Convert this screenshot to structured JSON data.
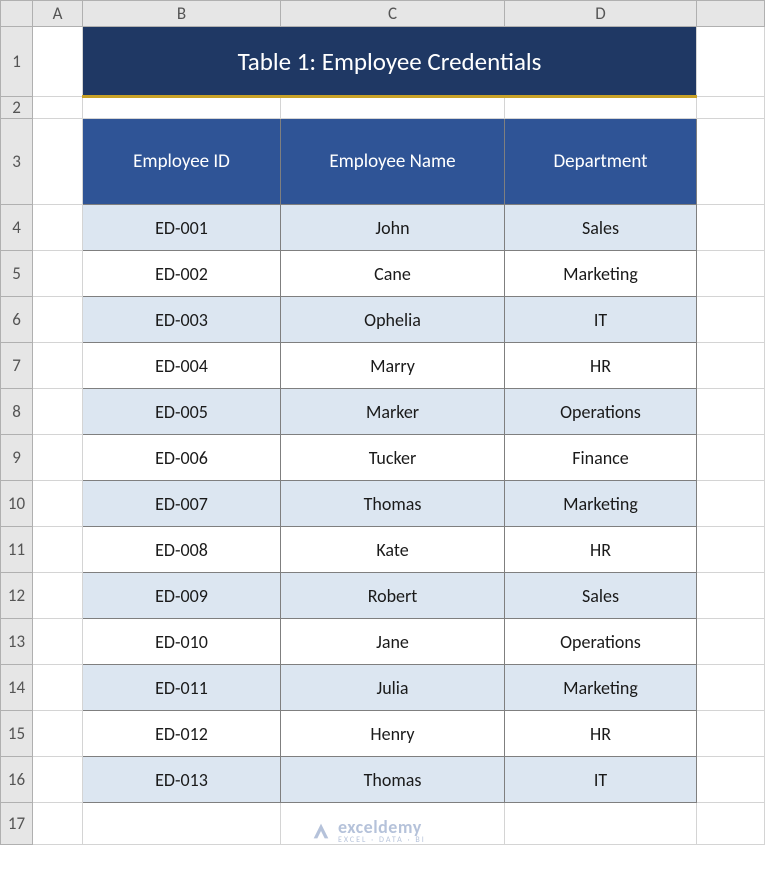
{
  "columns": [
    "",
    "A",
    "B",
    "C",
    "D",
    ""
  ],
  "row_numbers": [
    "1",
    "2",
    "3",
    "4",
    "5",
    "6",
    "7",
    "8",
    "9",
    "10",
    "11",
    "12",
    "13",
    "14",
    "15",
    "16",
    "17"
  ],
  "title": "Table 1: Employee Credentials",
  "headers": {
    "B": "Employee ID",
    "C": "Employee Name",
    "D": "Department"
  },
  "chart_data": {
    "type": "table",
    "title": "Table 1: Employee Credentials",
    "columns": [
      "Employee ID",
      "Employee Name",
      "Department"
    ],
    "rows": [
      [
        "ED-001",
        "John",
        "Sales"
      ],
      [
        "ED-002",
        "Cane",
        "Marketing"
      ],
      [
        "ED-003",
        "Ophelia",
        "IT"
      ],
      [
        "ED-004",
        "Marry",
        "HR"
      ],
      [
        "ED-005",
        "Marker",
        "Operations"
      ],
      [
        "ED-006",
        "Tucker",
        "Finance"
      ],
      [
        "ED-007",
        "Thomas",
        "Marketing"
      ],
      [
        "ED-008",
        "Kate",
        "HR"
      ],
      [
        "ED-009",
        "Robert",
        "Sales"
      ],
      [
        "ED-010",
        "Jane",
        "Operations"
      ],
      [
        "ED-011",
        "Julia",
        "Marketing"
      ],
      [
        "ED-012",
        "Henry",
        "HR"
      ],
      [
        "ED-013",
        "Thomas",
        "IT"
      ]
    ]
  },
  "watermark": {
    "name": "exceldemy",
    "tagline": "EXCEL · DATA · BI"
  }
}
